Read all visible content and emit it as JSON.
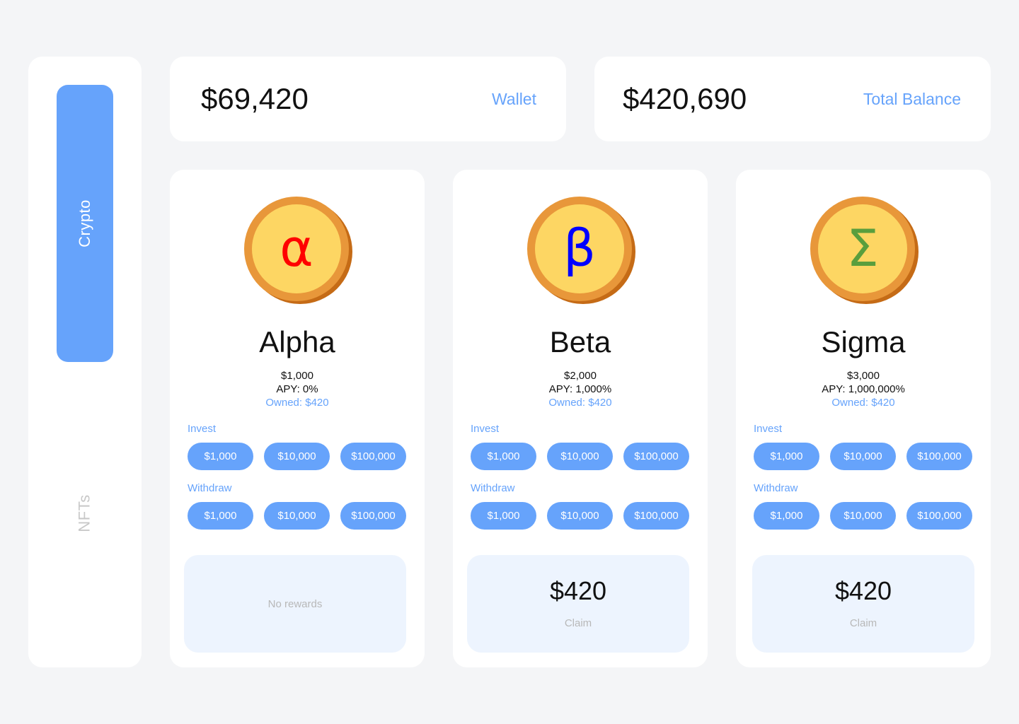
{
  "sidebar": {
    "items": [
      {
        "label": "Crypto",
        "active": true
      },
      {
        "label": "NFTs",
        "active": false
      }
    ]
  },
  "stats": {
    "wallet": {
      "amount": "$69,420",
      "label": "Wallet"
    },
    "total": {
      "amount": "$420,690",
      "label": "Total Balance"
    }
  },
  "colors": {
    "accent": "#66a3fb",
    "reward_bg": "#edf4fe",
    "coin_face": "#fdd663",
    "coin_rim": "#e8973a",
    "coin_shadow": "#c56b16"
  },
  "cards": [
    {
      "symbol": "α",
      "symbol_color": "#ff0000",
      "icon": "alpha-coin-icon",
      "name": "Alpha",
      "price": "$1,000",
      "apy": "APY: 0%",
      "owned": "Owned: $420",
      "invest_label": "Invest",
      "invest": [
        "$1,000",
        "$10,000",
        "$100,000"
      ],
      "withdraw_label": "Withdraw",
      "withdraw": [
        "$1,000",
        "$10,000",
        "$100,000"
      ],
      "reward": {
        "empty_text": "No rewards"
      }
    },
    {
      "symbol": "β",
      "symbol_color": "#0000ff",
      "icon": "beta-coin-icon",
      "name": "Beta",
      "price": "$2,000",
      "apy": "APY: 1,000%",
      "owned": "Owned: $420",
      "invest_label": "Invest",
      "invest": [
        "$1,000",
        "$10,000",
        "$100,000"
      ],
      "withdraw_label": "Withdraw",
      "withdraw": [
        "$1,000",
        "$10,000",
        "$100,000"
      ],
      "reward": {
        "amount": "$420",
        "claim": "Claim"
      }
    },
    {
      "symbol": "Σ",
      "symbol_color": "#5a9e3d",
      "icon": "sigma-coin-icon",
      "name": "Sigma",
      "price": "$3,000",
      "apy": "APY: 1,000,000%",
      "owned": "Owned: $420",
      "invest_label": "Invest",
      "invest": [
        "$1,000",
        "$10,000",
        "$100,000"
      ],
      "withdraw_label": "Withdraw",
      "withdraw": [
        "$1,000",
        "$10,000",
        "$100,000"
      ],
      "reward": {
        "amount": "$420",
        "claim": "Claim"
      }
    }
  ]
}
